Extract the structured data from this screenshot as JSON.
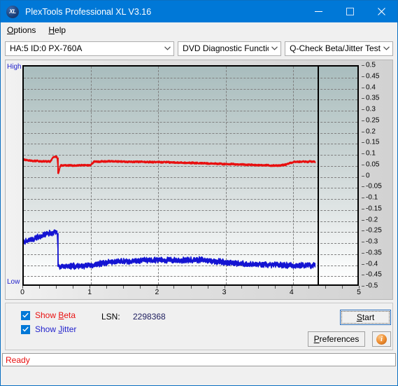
{
  "window": {
    "title": "PlexTools Professional XL V3.16",
    "app_icon": "xl-logo-icon",
    "minimize": "minimize-icon",
    "maximize": "maximize-icon",
    "close": "close-icon"
  },
  "menu": {
    "items": [
      {
        "label": "Options",
        "accel": "O"
      },
      {
        "label": "Help",
        "accel": "H"
      }
    ]
  },
  "toolbar": {
    "drive_select": "HA:5 ID:0  PX-760A",
    "function_select": "DVD Diagnostic Functions",
    "test_select": "Q-Check Beta/Jitter Test",
    "dropdown_icon": "chevron-down-icon"
  },
  "controls": {
    "show_beta_label": "Show Beta",
    "show_beta_checked": true,
    "show_jitter_label": "Show Jitter",
    "show_jitter_checked": true,
    "lsn_label": "LSN:",
    "lsn_value": "2298368",
    "start_label": "Start",
    "preferences_label": "Preferences",
    "info_label": "i",
    "beta_color": "#e81010",
    "jitter_color": "#2222cc"
  },
  "statusbar": {
    "text": "Ready",
    "color": "#e81010"
  },
  "chart_data": {
    "type": "line",
    "title": "Q-Check Beta/Jitter Test",
    "xlabel": "",
    "ylabel": "",
    "xlim": [
      0,
      5
    ],
    "ylim": [
      -0.5,
      0.5
    ],
    "grid": true,
    "legend_position": "bottom-left",
    "axis_high_label": "High",
    "axis_low_label": "Low",
    "x_ticks": [
      0,
      1,
      2,
      3,
      4,
      5
    ],
    "x_tick_labels": [
      "0",
      "1",
      "2",
      "3",
      "4",
      "5"
    ],
    "y_ticks": [
      0.5,
      0.45,
      0.4,
      0.35,
      0.3,
      0.25,
      0.2,
      0.15,
      0.1,
      0.05,
      0,
      -0.05,
      -0.1,
      -0.15,
      -0.2,
      -0.25,
      -0.3,
      -0.35,
      -0.4,
      -0.45,
      -0.5
    ],
    "y_tick_labels": [
      "0.5",
      "0.45",
      "0.4",
      "0.35",
      "0.3",
      "0.25",
      "0.2",
      "0.15",
      "0.1",
      "0.05",
      "0",
      "-0.05",
      "-0.1",
      "-0.15",
      "-0.2",
      "-0.25",
      "-0.3",
      "-0.35",
      "-0.4",
      "-0.45",
      "-0.5"
    ],
    "data_end_marker_x": 4.37,
    "series": [
      {
        "name": "Beta",
        "color": "#e81010",
        "x": [
          0.0,
          0.05,
          0.1,
          0.15,
          0.2,
          0.25,
          0.3,
          0.35,
          0.4,
          0.44,
          0.46,
          0.48,
          0.5,
          0.52,
          0.55,
          0.6,
          0.7,
          0.8,
          0.9,
          1.0,
          1.05,
          1.1,
          1.2,
          1.3,
          1.4,
          1.5,
          1.6,
          1.7,
          1.8,
          1.9,
          2.0,
          2.1,
          2.2,
          2.3,
          2.4,
          2.5,
          2.6,
          2.7,
          2.8,
          2.9,
          3.0,
          3.1,
          3.2,
          3.3,
          3.4,
          3.5,
          3.6,
          3.7,
          3.8,
          3.9,
          4.0,
          4.05,
          4.1,
          4.15,
          4.2,
          4.25,
          4.3,
          4.35,
          4.37
        ],
        "y": [
          0.072,
          0.07,
          0.068,
          0.066,
          0.067,
          0.065,
          0.066,
          0.064,
          0.065,
          0.084,
          0.086,
          0.085,
          0.084,
          0.01,
          0.046,
          0.046,
          0.046,
          0.046,
          0.047,
          0.047,
          0.063,
          0.064,
          0.064,
          0.065,
          0.064,
          0.064,
          0.063,
          0.063,
          0.062,
          0.062,
          0.061,
          0.061,
          0.06,
          0.06,
          0.059,
          0.058,
          0.057,
          0.056,
          0.055,
          0.054,
          0.053,
          0.052,
          0.051,
          0.05,
          0.049,
          0.048,
          0.047,
          0.046,
          0.045,
          0.048,
          0.058,
          0.062,
          0.063,
          0.064,
          0.064,
          0.063,
          0.064,
          0.063,
          0.062
        ]
      },
      {
        "name": "Jitter",
        "color": "#1414d2",
        "x": [
          0.0,
          0.05,
          0.1,
          0.15,
          0.2,
          0.25,
          0.3,
          0.35,
          0.4,
          0.44,
          0.46,
          0.48,
          0.5,
          0.52,
          0.55,
          0.6,
          0.7,
          0.8,
          0.9,
          1.0,
          1.1,
          1.2,
          1.3,
          1.4,
          1.5,
          1.6,
          1.7,
          1.8,
          1.9,
          2.0,
          2.1,
          2.2,
          2.3,
          2.4,
          2.5,
          2.6,
          2.7,
          2.8,
          2.9,
          3.0,
          3.1,
          3.2,
          3.3,
          3.4,
          3.5,
          3.6,
          3.7,
          3.8,
          3.9,
          4.0,
          4.1,
          4.2,
          4.3,
          4.37
        ],
        "y": [
          -0.305,
          -0.3,
          -0.296,
          -0.292,
          -0.286,
          -0.281,
          -0.276,
          -0.271,
          -0.266,
          -0.262,
          -0.261,
          -0.261,
          -0.261,
          -0.415,
          -0.418,
          -0.418,
          -0.417,
          -0.417,
          -0.416,
          -0.414,
          -0.408,
          -0.402,
          -0.398,
          -0.396,
          -0.395,
          -0.394,
          -0.392,
          -0.39,
          -0.389,
          -0.388,
          -0.389,
          -0.39,
          -0.391,
          -0.39,
          -0.389,
          -0.388,
          -0.39,
          -0.392,
          -0.395,
          -0.398,
          -0.402,
          -0.405,
          -0.407,
          -0.409,
          -0.41,
          -0.411,
          -0.412,
          -0.412,
          -0.413,
          -0.413,
          -0.414,
          -0.414,
          -0.414,
          -0.414
        ],
        "band": 0.022,
        "band_note": "noisy trace; vertical spread around mean"
      }
    ]
  }
}
